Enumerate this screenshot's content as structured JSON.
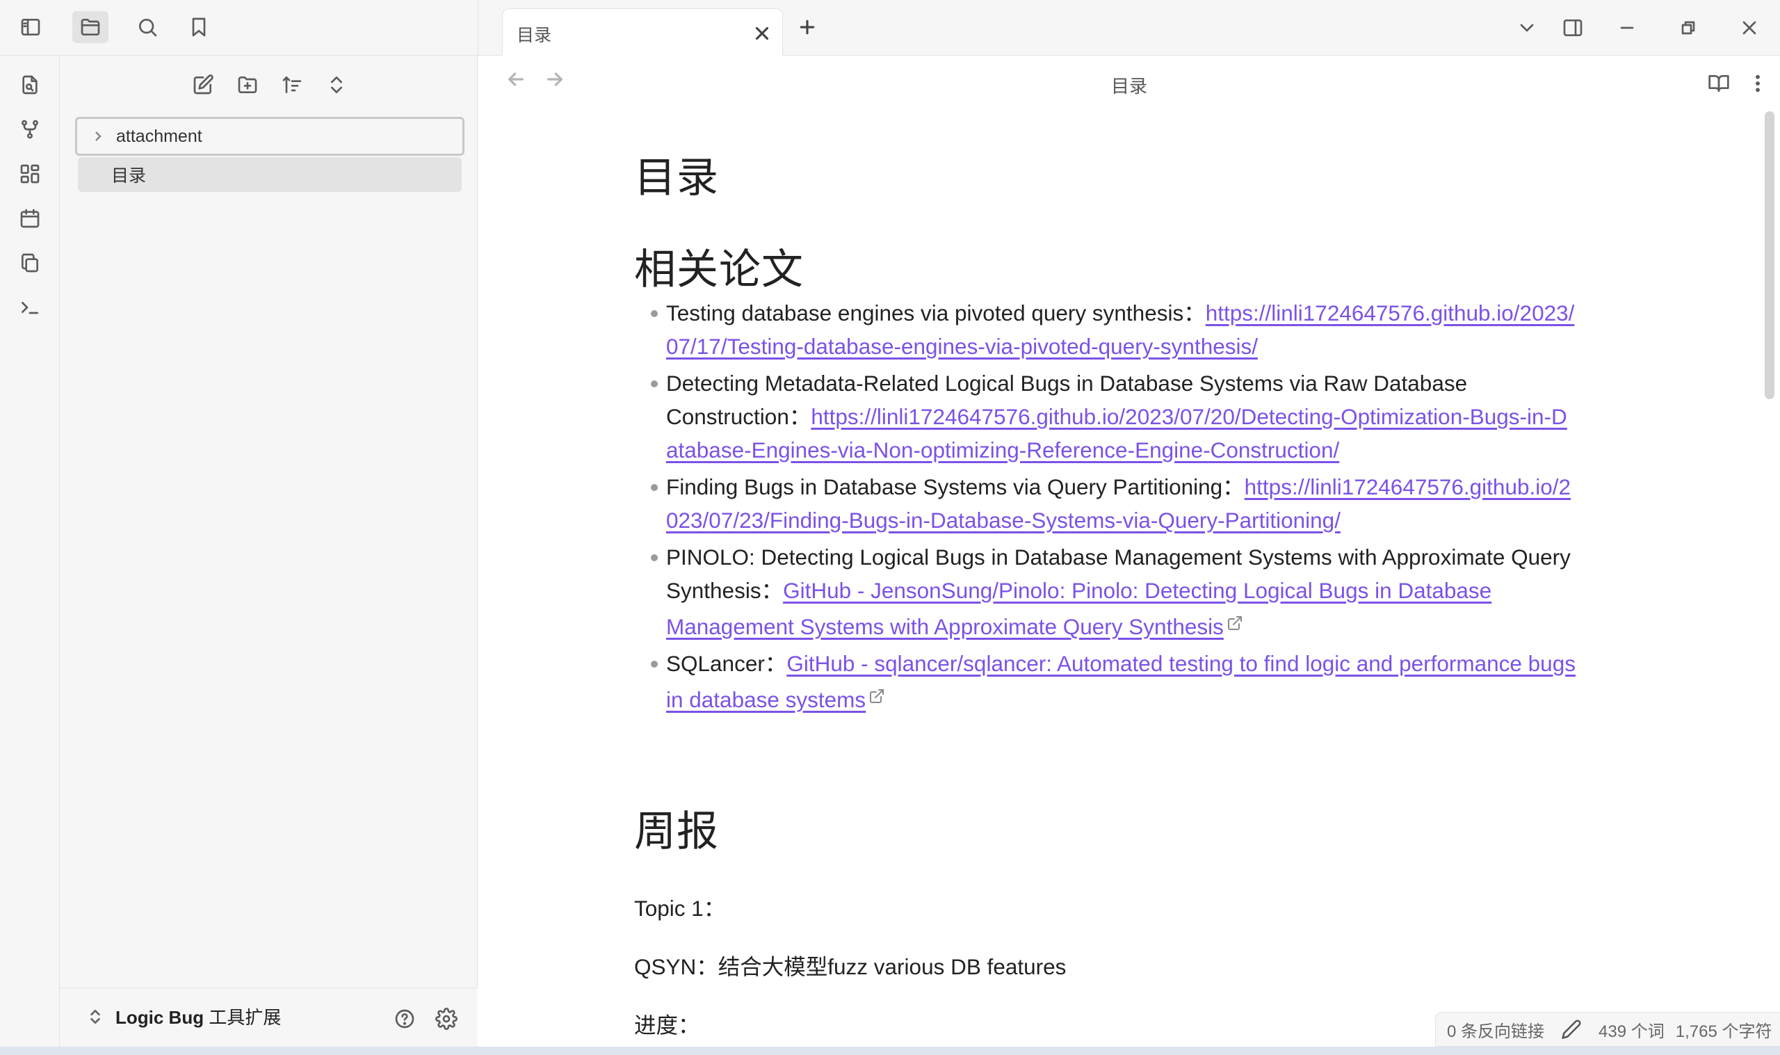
{
  "tab": {
    "title": "目录"
  },
  "view_header": {
    "title": "目录"
  },
  "file_tree": {
    "folder": "attachment",
    "file": "目录"
  },
  "vault": {
    "name_bold": "Logic Bug",
    "name_rest": " 工具扩展"
  },
  "doc": {
    "title": "目录",
    "papers_heading": "相关论文",
    "papers": [
      {
        "text": "Testing database engines via pivoted query synthesis：",
        "link": "https://linli1724647576.github.io/2023/07/17/Testing-database-engines-via-pivoted-query-synthesis/"
      },
      {
        "text": "Detecting Metadata-Related Logical Bugs in Database Systems via Raw Database Construction：",
        "link": "https://linli1724647576.github.io/2023/07/20/Detecting-Optimization-Bugs-in-Database-Engines-via-Non-optimizing-Reference-Engine-Construction/"
      },
      {
        "text": "Finding Bugs in Database Systems via Query Partitioning：",
        "link": "https://linli1724647576.github.io/2023/07/23/Finding-Bugs-in-Database-Systems-via-Query-Partitioning/"
      },
      {
        "text": "PINOLO: Detecting Logical Bugs in Database Management Systems with Approximate Query Synthesis：",
        "link": "GitHub - JensonSung/Pinolo: Pinolo: Detecting Logical Bugs in Database Management Systems with Approximate Query Synthesis"
      },
      {
        "text": "SQLancer：",
        "link": "GitHub - sqlancer/sqlancer: Automated testing to find logic and performance bugs in database systems"
      }
    ],
    "weekly_heading": "周报",
    "paragraphs": [
      "Topic 1：",
      "QSYN：结合大模型fuzz various DB features",
      "进度："
    ]
  },
  "status": {
    "backlinks": "0 条反向链接",
    "words": "439 个词",
    "chars": "1,765 个字符"
  },
  "colors": {
    "link": "#7b52e6",
    "sidebar_bg": "#f6f6f6",
    "active_bg": "#e3e3e3"
  }
}
